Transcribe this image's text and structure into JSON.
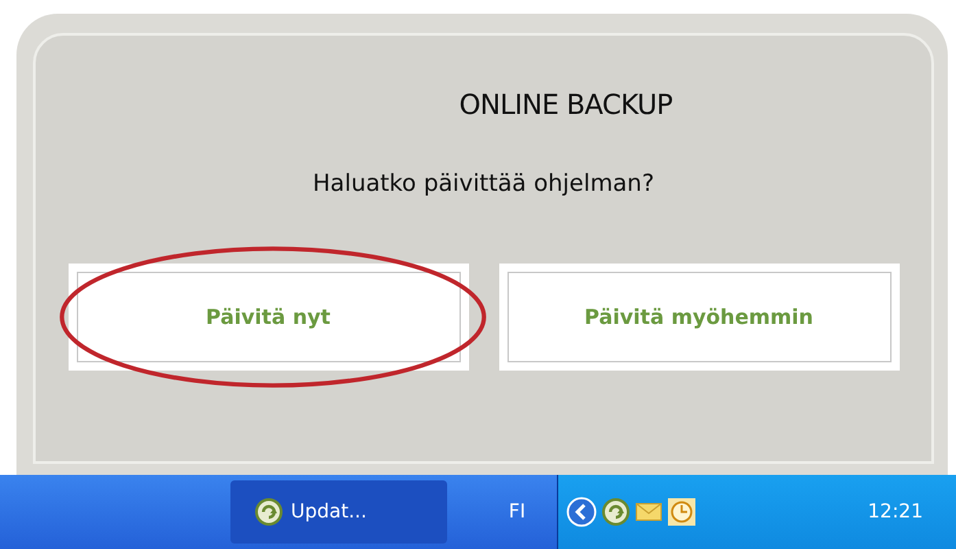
{
  "dialog": {
    "title": "ONLINE BACKUP",
    "question": "Haluatko päivittää ohjelman?",
    "buttons": [
      {
        "label": "Päivitä nyt",
        "circled": true
      },
      {
        "label": "Päivitä myöhemmin",
        "circled": false
      }
    ]
  },
  "taskbar": {
    "task": {
      "label": "Updat..."
    },
    "language": "FI",
    "time": "12:21"
  }
}
